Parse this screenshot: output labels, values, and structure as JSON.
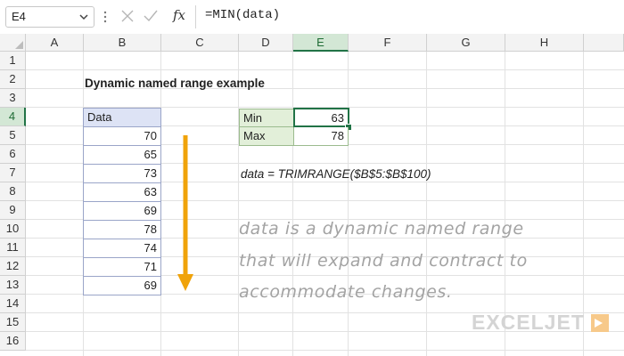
{
  "formula_bar": {
    "name_box": "E4",
    "fx_label": "fx",
    "formula": "=MIN(data)"
  },
  "columns": [
    "A",
    "B",
    "C",
    "D",
    "E",
    "F",
    "G",
    "H"
  ],
  "selected_column": "E",
  "rows": [
    "1",
    "2",
    "3",
    "4",
    "5",
    "6",
    "7",
    "8",
    "9",
    "10",
    "11",
    "12",
    "13",
    "14",
    "15",
    "16"
  ],
  "selected_row": "4",
  "sheet": {
    "title": "Dynamic named range example",
    "data_table": {
      "header": "Data",
      "values": [
        "70",
        "65",
        "73",
        "63",
        "69",
        "78",
        "74",
        "71",
        "69"
      ]
    },
    "summary": [
      {
        "label": "Min",
        "value": "63"
      },
      {
        "label": "Max",
        "value": "78"
      }
    ],
    "name_definition": "data = TRIMRANGE($B$5:$B$100)",
    "note_lines": [
      "data is a dynamic named range",
      "that will expand and contract to",
      "accommodate changes."
    ],
    "arrow_color": "#f0a30a"
  },
  "logo": {
    "text": "EXCELJET"
  },
  "colors": {
    "accent": "#217346",
    "table_header": "#dde3f5",
    "label_fill": "#e2efd9"
  }
}
